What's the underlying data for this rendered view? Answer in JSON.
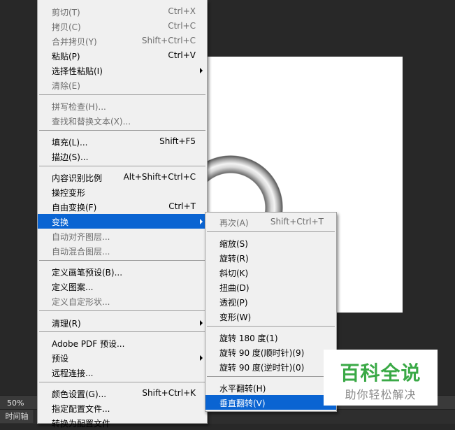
{
  "status": {
    "zoom": "50%",
    "bottom_tab": "时间轴"
  },
  "edit_menu": {
    "items": [
      {
        "label": "剪切(T)",
        "shortcut": "Ctrl+X",
        "disabled": true
      },
      {
        "label": "拷贝(C)",
        "shortcut": "Ctrl+C",
        "disabled": true
      },
      {
        "label": "合并拷贝(Y)",
        "shortcut": "Shift+Ctrl+C",
        "disabled": true
      },
      {
        "label": "粘贴(P)",
        "shortcut": "Ctrl+V",
        "disabled": false
      },
      {
        "label": "选择性粘贴(I)",
        "shortcut": "",
        "disabled": false,
        "submenu": true
      },
      {
        "label": "清除(E)",
        "shortcut": "",
        "disabled": true
      },
      {
        "label": "拼写检查(H)...",
        "shortcut": "",
        "disabled": true
      },
      {
        "label": "查找和替换文本(X)...",
        "shortcut": "",
        "disabled": true
      },
      {
        "label": "填充(L)...",
        "shortcut": "Shift+F5",
        "disabled": false
      },
      {
        "label": "描边(S)...",
        "shortcut": "",
        "disabled": false
      },
      {
        "label": "内容识别比例",
        "shortcut": "Alt+Shift+Ctrl+C",
        "disabled": false
      },
      {
        "label": "操控变形",
        "shortcut": "",
        "disabled": false
      },
      {
        "label": "自由变换(F)",
        "shortcut": "Ctrl+T",
        "disabled": false
      },
      {
        "label": "变换",
        "shortcut": "",
        "disabled": false,
        "submenu": true,
        "highlighted": true
      },
      {
        "label": "自动对齐图层...",
        "shortcut": "",
        "disabled": true
      },
      {
        "label": "自动混合图层...",
        "shortcut": "",
        "disabled": true
      },
      {
        "label": "定义画笔预设(B)...",
        "shortcut": "",
        "disabled": false
      },
      {
        "label": "定义图案...",
        "shortcut": "",
        "disabled": false
      },
      {
        "label": "定义自定形状...",
        "shortcut": "",
        "disabled": true
      },
      {
        "label": "清理(R)",
        "shortcut": "",
        "disabled": false,
        "submenu": true
      },
      {
        "label": "Adobe PDF 预设...",
        "shortcut": "",
        "disabled": false
      },
      {
        "label": "预设",
        "shortcut": "",
        "disabled": false,
        "submenu": true
      },
      {
        "label": "远程连接...",
        "shortcut": "",
        "disabled": false
      },
      {
        "label": "颜色设置(G)...",
        "shortcut": "Shift+Ctrl+K",
        "disabled": false
      },
      {
        "label": "指定配置文件...",
        "shortcut": "",
        "disabled": false
      },
      {
        "label": "转换为配置文件",
        "shortcut": "",
        "disabled": false
      }
    ]
  },
  "transform_submenu": {
    "items": [
      {
        "label": "再次(A)",
        "shortcut": "Shift+Ctrl+T",
        "disabled": true
      },
      {
        "label": "缩放(S)",
        "shortcut": "",
        "disabled": false
      },
      {
        "label": "旋转(R)",
        "shortcut": "",
        "disabled": false
      },
      {
        "label": "斜切(K)",
        "shortcut": "",
        "disabled": false
      },
      {
        "label": "扭曲(D)",
        "shortcut": "",
        "disabled": false
      },
      {
        "label": "透视(P)",
        "shortcut": "",
        "disabled": false
      },
      {
        "label": "变形(W)",
        "shortcut": "",
        "disabled": false
      },
      {
        "label": "旋转 180 度(1)",
        "shortcut": "",
        "disabled": false
      },
      {
        "label": "旋转 90 度(顺时针)(9)",
        "shortcut": "",
        "disabled": false
      },
      {
        "label": "旋转 90 度(逆时针)(0)",
        "shortcut": "",
        "disabled": false
      },
      {
        "label": "水平翻转(H)",
        "shortcut": "",
        "disabled": false
      },
      {
        "label": "垂直翻转(V)",
        "shortcut": "",
        "disabled": false,
        "highlighted": true
      }
    ]
  },
  "watermark": {
    "title": "百科全说",
    "subtitle": "助你轻松解决"
  }
}
